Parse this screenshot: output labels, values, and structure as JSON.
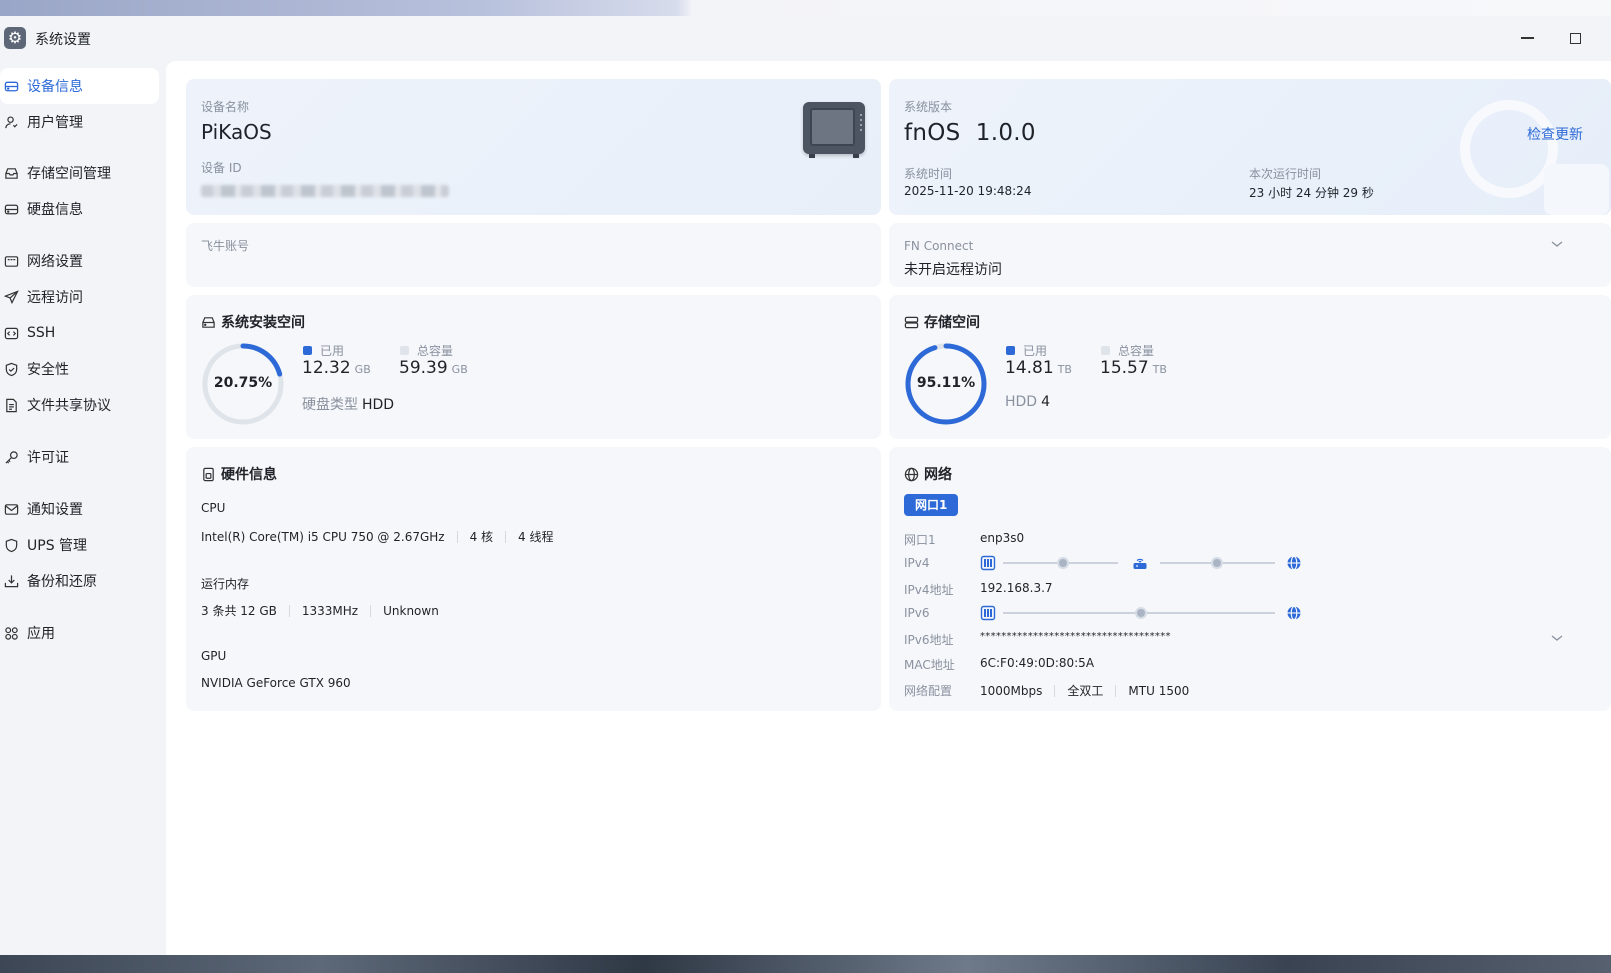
{
  "window": {
    "title": "系统设置",
    "icon": "gear-icon",
    "controls": [
      "minimize-icon",
      "maximize-icon"
    ]
  },
  "sidebar": {
    "items": [
      {
        "label": "设备信息",
        "icon": "device-info-icon",
        "active": true
      },
      {
        "label": "用户管理",
        "icon": "user-icon"
      },
      {
        "label": "存储空间管理",
        "icon": "storage-icon"
      },
      {
        "label": "硬盘信息",
        "icon": "disk-icon"
      },
      {
        "label": "网络设置",
        "icon": "network-icon"
      },
      {
        "label": "远程访问",
        "icon": "send-icon"
      },
      {
        "label": "SSH",
        "icon": "ssh-icon"
      },
      {
        "label": "安全性",
        "icon": "shield-icon"
      },
      {
        "label": "文件共享协议",
        "icon": "file-icon"
      },
      {
        "label": "许可证",
        "icon": "key-icon"
      },
      {
        "label": "通知设置",
        "icon": "mail-icon"
      },
      {
        "label": "UPS 管理",
        "icon": "ups-shield-icon"
      },
      {
        "label": "备份和还原",
        "icon": "backup-icon"
      },
      {
        "label": "应用",
        "icon": "apps-icon"
      }
    ]
  },
  "device": {
    "name_label": "设备名称",
    "name": "PiKaOS",
    "id_label": "设备 ID",
    "id_masked": true
  },
  "system": {
    "version_label": "系统版本",
    "version": "fnOS  1.0.0",
    "check_update": "检查更新",
    "time_label": "系统时间",
    "time": "2025-11-20 19:48:24",
    "uptime_label": "本次运行时间",
    "uptime": "23 小时 24 分钟 29 秒"
  },
  "fnaccount": {
    "label": "飞牛账号"
  },
  "fnconnect": {
    "label": "FN Connect",
    "status": "未开启远程访问"
  },
  "install_space": {
    "title": "系统安装空间",
    "percent_label": "20.75%",
    "percent": 20.75,
    "used_label": "已用",
    "used": "12.32",
    "used_unit": "GB",
    "total_label": "总容量",
    "total": "59.39",
    "total_unit": "GB",
    "disk_type_label": "硬盘类型",
    "disk_type": "HDD"
  },
  "storage_space": {
    "title": "存储空间",
    "percent_label": "95.11%",
    "percent": 95.11,
    "used_label": "已用",
    "used": "14.81",
    "used_unit": "TB",
    "total_label": "总容量",
    "total": "15.57",
    "total_unit": "TB",
    "disk_type_label": "HDD",
    "disk_count": "4"
  },
  "hardware": {
    "title": "硬件信息",
    "cpu_label": "CPU",
    "cpu_model": "Intel(R) Core(TM) i5 CPU 750 @ 2.67GHz",
    "cpu_cores": "4 核",
    "cpu_threads": "4 线程",
    "mem_label": "运行内存",
    "mem_total": "3 条共 12 GB",
    "mem_speed": "1333MHz",
    "mem_type": "Unknown",
    "gpu_label": "GPU",
    "gpu_model": "NVIDIA GeForce GTX 960"
  },
  "network": {
    "title": "网络",
    "tab": "网口1",
    "rows": {
      "port_label": "网口1",
      "port": "enp3s0",
      "ipv4_label": "IPv4",
      "ipv4_addr_label": "IPv4地址",
      "ipv4_addr": "192.168.3.7",
      "ipv6_label": "IPv6",
      "ipv6_addr_label": "IPv6地址",
      "ipv6_addr": "************************************",
      "mac_label": "MAC地址",
      "mac": "6C:F0:49:0D:80:5A",
      "config_label": "网络配置",
      "speed": "1000Mbps",
      "duplex": "全双工",
      "mtu": "MTU 1500"
    }
  },
  "colors": {
    "accent": "#2e6ad7",
    "ring_track": "#dfe3ea",
    "legend_total": "#dfe3ea"
  }
}
